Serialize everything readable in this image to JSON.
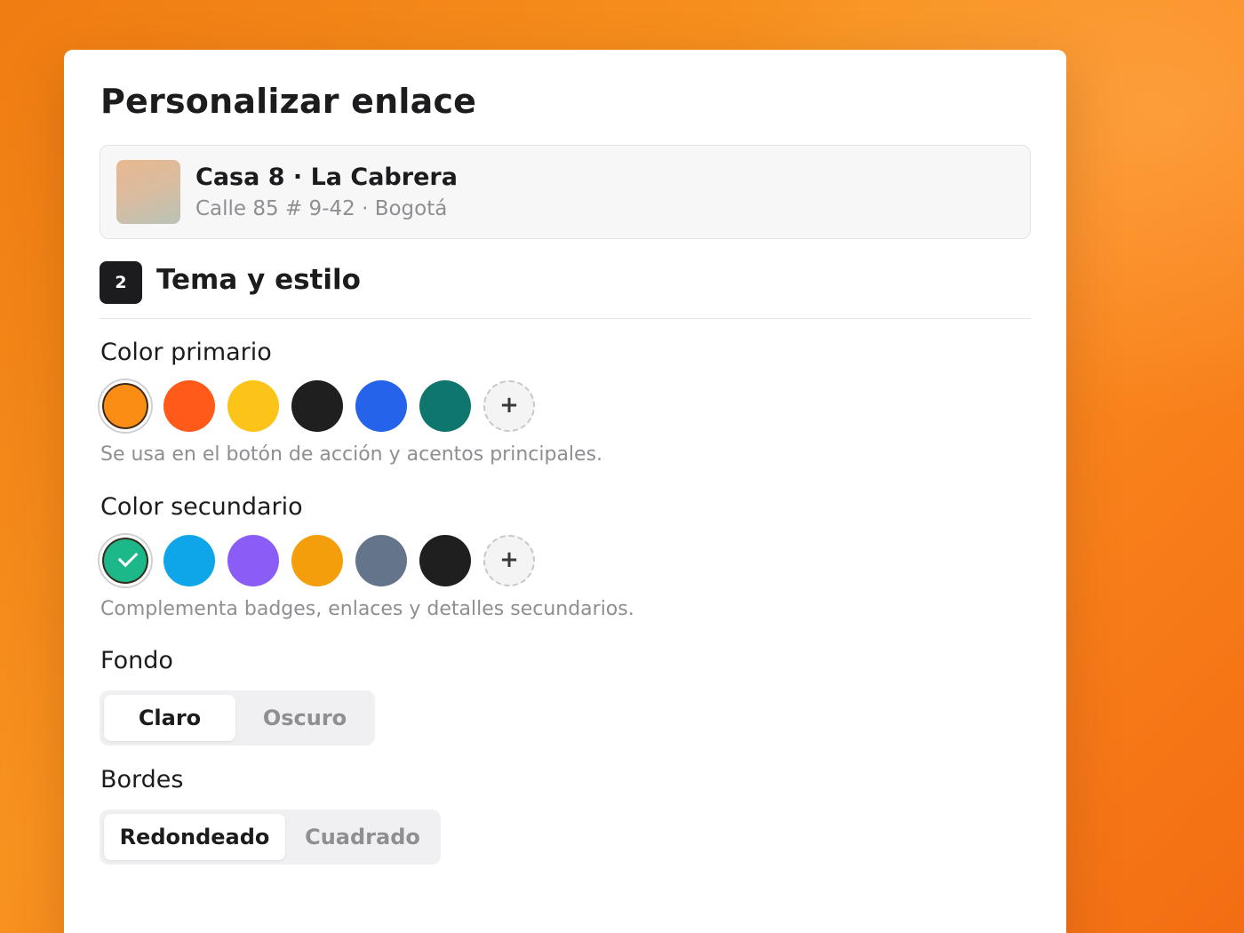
{
  "page": {
    "title": "Personalizar enlace"
  },
  "property": {
    "name": "Casa 8 · La Cabrera",
    "address": "Calle 85 # 9-42 · Bogotá"
  },
  "section": {
    "step": "2",
    "title": "Tema y estilo"
  },
  "primary_color": {
    "label": "Color primario",
    "hint": "Se usa en el botón de acción y acentos principales.",
    "swatches": [
      "#fb8c14",
      "#ff5a1a",
      "#fcc419",
      "#1f1f20",
      "#2563eb",
      "#0f766e"
    ],
    "selected": "#fb8c14",
    "add_label": "+"
  },
  "secondary_color": {
    "label": "Color secundario",
    "hint": "Complementa badges, enlaces y detalles secundarios.",
    "swatches": [
      "#1db889",
      "#0ea5e9",
      "#8b5cf6",
      "#f59e0b",
      "#64748b",
      "#1f1f20"
    ],
    "selected": "#1db889",
    "add_label": "+"
  },
  "background": {
    "label": "Fondo",
    "options": [
      "Claro",
      "Oscuro"
    ],
    "selected": "Claro"
  },
  "borders": {
    "label": "Bordes",
    "options": [
      "Redondeado",
      "Cuadrado"
    ],
    "selected": "Redondeado"
  }
}
